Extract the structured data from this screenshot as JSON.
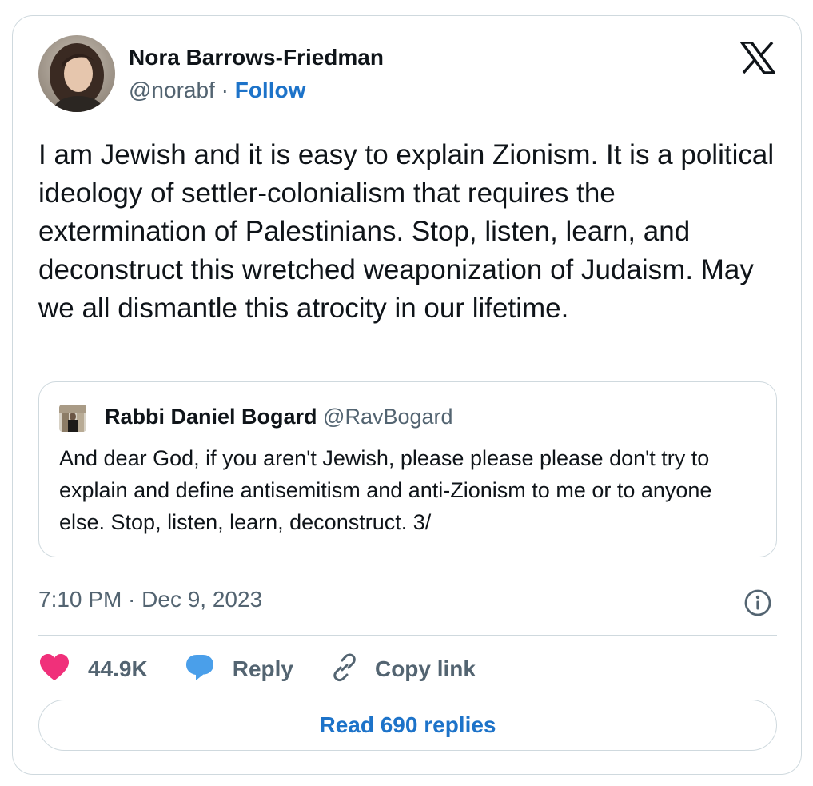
{
  "author": {
    "name": "Nora Barrows-Friedman",
    "handle": "@norabf",
    "separator": " · ",
    "follow_label": "Follow"
  },
  "tweet": {
    "text": "I am Jewish and it is easy to explain Zionism. It is a political ideology of settler-colonialism that requires the extermination of Palestinians. Stop, listen, learn, and deconstruct this wretched weaponization of Judaism. May we all dismantle this atrocity in our lifetime."
  },
  "quoted_tweet": {
    "name": "Rabbi Daniel Bogard",
    "handle": "@RavBogard",
    "text": "And dear God, if you aren't Jewish, please please please don't try to explain and define antisemitism and anti-Zionism to me or to anyone else. Stop, listen, learn, deconstruct. 3/"
  },
  "timestamp": "7:10 PM · Dec 9, 2023",
  "actions": {
    "like_count": "44.9K",
    "reply_label": "Reply",
    "copy_link_label": "Copy link"
  },
  "read_replies_label": "Read 690 replies",
  "icons": {
    "brand": "x-logo-icon",
    "info": "info-icon",
    "like": "heart-icon",
    "reply": "speech-bubble-icon",
    "copy": "link-icon"
  },
  "colors": {
    "link": "#1d73c9",
    "heart": "#f0307a",
    "reply_bubble": "#4a9fea",
    "secondary_text": "#536471",
    "border": "#cfd9de"
  }
}
